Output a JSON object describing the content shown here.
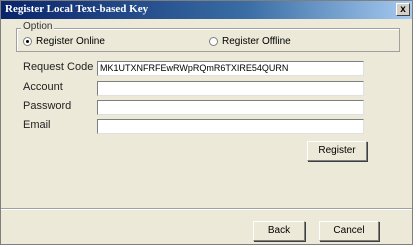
{
  "window": {
    "title": "Register Local Text-based Key",
    "close_label": "x"
  },
  "option_group": {
    "label": "Option",
    "online_label": "Register Online",
    "offline_label": "Register Offline",
    "selected": "online"
  },
  "fields": {
    "request_code_label": "Request Code",
    "request_code_value": "MK1UTXNFRFEwRWpRQmR6TXIRE54QURN",
    "account_label": "Account",
    "password_label": "Password",
    "email_label": "Email"
  },
  "buttons": {
    "register": "Register",
    "back": "Back",
    "cancel": "Cancel"
  }
}
